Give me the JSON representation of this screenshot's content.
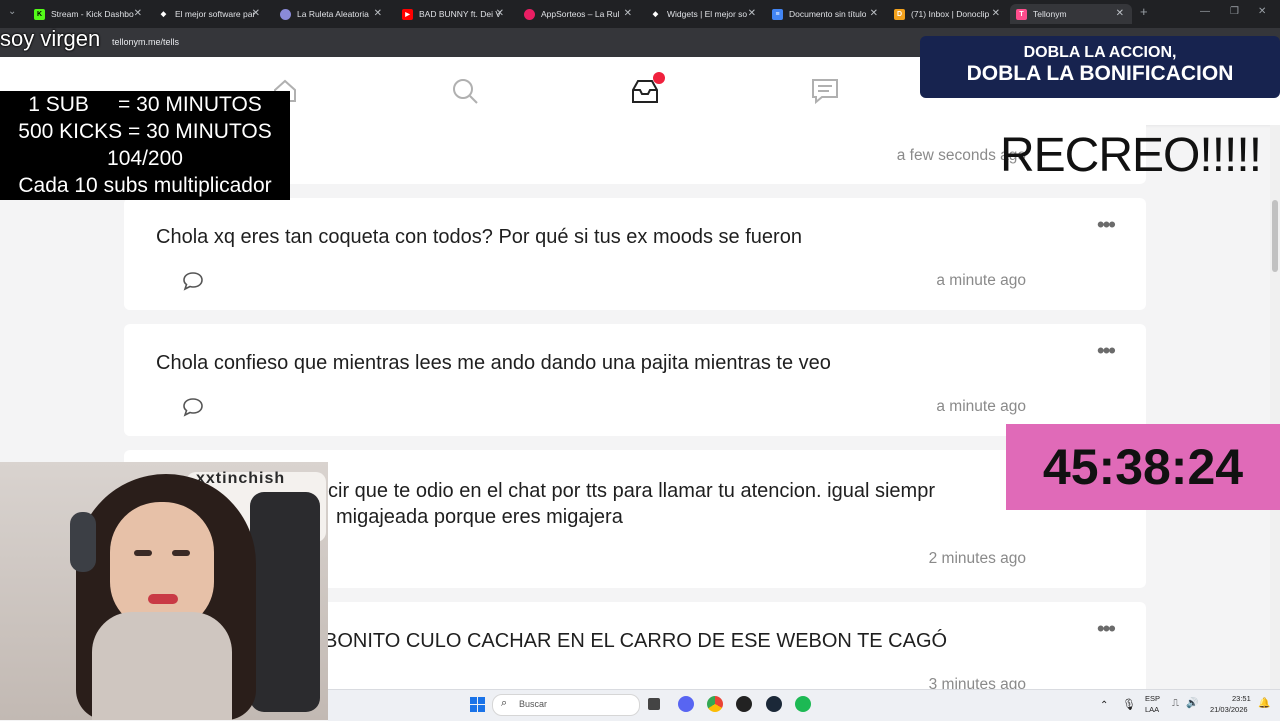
{
  "browser": {
    "tabs": [
      {
        "title": "Stream - Kick Dashbo",
        "color": "#53fc18",
        "glyph": "K"
      },
      {
        "title": "El mejor software par",
        "color": "#ffffff",
        "glyph": "◆"
      },
      {
        "title": "La Ruleta Aleatoria",
        "color": "#8a8ad8",
        "glyph": "●"
      },
      {
        "title": "BAD BUNNY ft. Dei V",
        "color": "#ff0000",
        "glyph": "▶"
      },
      {
        "title": "AppSorteos – La Rul",
        "color": "#e91e63",
        "glyph": "●"
      },
      {
        "title": "Widgets | El mejor so",
        "color": "#ffffff",
        "glyph": "◆"
      },
      {
        "title": "Documento sin título",
        "color": "#4285f4",
        "glyph": "≡"
      },
      {
        "title": "(71) Inbox | Donoclip",
        "color": "#f4a21d",
        "glyph": "D"
      },
      {
        "title": "Tellonym",
        "color": "#ff4d8d",
        "glyph": "T"
      }
    ],
    "url": "tellonym.me/tells"
  },
  "feed": {
    "first_time": "a few seconds ago",
    "cards": [
      {
        "text": "Chola xq eres tan coqueta con todos? Por qué si tus ex moods se fueron",
        "time": "a minute ago"
      },
      {
        "text": "Chola confieso que mientras lees me ando dando una pajita mientras te veo",
        "time": "a minute ago"
      },
      {
        "text_line1": "cir que te odio en el chat por tts para llamar tu atencion. igual siempr",
        "text_line2": "migajeada porque eres migajera",
        "time": "2 minutes ago"
      },
      {
        "text": "BONITO CULO CACHAR EN EL CARRO DE ESE WEBON TE CAGÓ",
        "time": "3 minutes ago"
      }
    ]
  },
  "overlay": {
    "title": "soy virgen",
    "subs_lines": [
      "1 SUB     = 30 MINUTOS",
      "500 KICKS = 30 MINUTOS",
      "104/200",
      "Cada 10 subs multiplicador"
    ],
    "promo_line1": "DOBLA LA ACCION,",
    "promo_line2": "DOBLA LA BONIFICACION",
    "recreo": "RECREO!!!!!",
    "timer": "45:38:24",
    "webcam_banner": "xxtinchish"
  },
  "taskbar": {
    "search_placeholder": "Buscar",
    "lang1": "ESP",
    "lang2": "LAA",
    "time": "23:51",
    "date": "21/03/2026"
  }
}
